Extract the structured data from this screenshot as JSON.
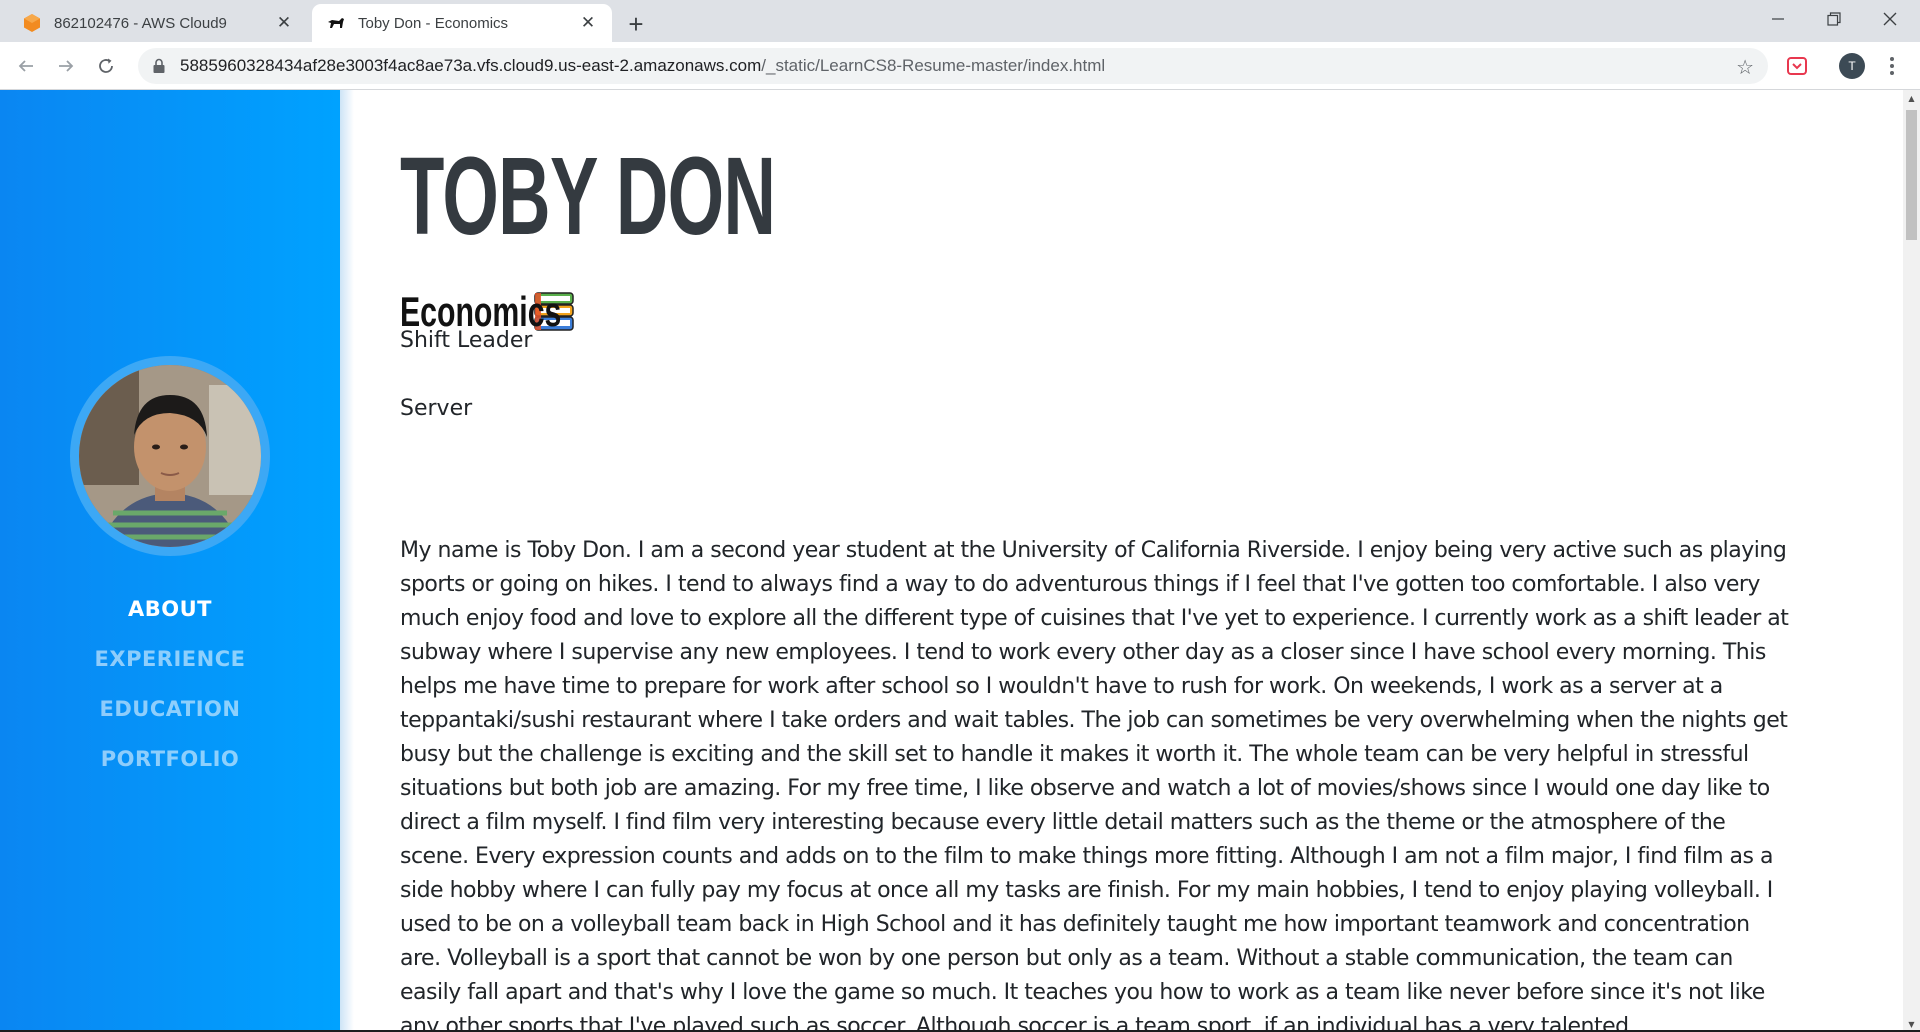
{
  "browser": {
    "tabs": [
      {
        "title": "862102476 - AWS Cloud9",
        "icon": "aws-cloud9-icon",
        "active": false
      },
      {
        "title": "Toby Don - Economics",
        "icon": "dog-favicon-icon",
        "active": true
      }
    ],
    "url_host": "5885960328434af28e3003f4ac8ae73a.vfs.cloud9.us-east-2.amazonaws.com",
    "url_path": "/_static/LearnCS8-Resume-master/index.html",
    "profile_initial": "T"
  },
  "sidebar": {
    "gradient_start": "#0a86f2",
    "gradient_end": "#00a2ff",
    "nav": [
      {
        "label": "ABOUT",
        "active": true
      },
      {
        "label": "EXPERIENCE",
        "active": false
      },
      {
        "label": "EDUCATION",
        "active": false
      },
      {
        "label": "PORTFOLIO",
        "active": false
      }
    ]
  },
  "about": {
    "name": "TOBY DON",
    "subheading": "Economics",
    "subheading_icon": "books-icon",
    "roles": [
      "Shift Leader",
      "Server"
    ],
    "bio": "My name is Toby Don. I am a second year student at the University of California Riverside. I enjoy being very active such as playing sports or going on hikes. I tend to always find a way to do adventurous things if I feel that I've gotten too comfortable. I also very much enjoy food and love to explore all the different type of cuisines that I've yet to experience. I currently work as a shift leader at subway where I supervise any new employees. I tend to work every other day as a closer since I have school every morning. This helps me have time to prepare for work after school so I wouldn't have to rush for work. On weekends, I work as a server at a teppantaki/sushi restaurant where I take orders and wait tables. The job can sometimes be very overwhelming when the nights get busy but the challenge is exciting and the skill set to handle it makes it worth it. The whole team can be very helpful in stressful situations but both job are amazing. For my free time, I like observe and watch a lot of movies/shows since I would one day like to direct a film myself. I find film very interesting because every little detail matters such as the theme or the atmosphere of the scene. Every expression counts and adds on to the film to make things more fitting. Although I am not a film major, I find film as a side hobby where I can fully pay my focus at once all my tasks are finish. For my main hobbies, I tend to enjoy playing volleyball. I used to be on a volleyball team back in High School and it has definitely taught me how important teamwork and concentration are. Volleyball is a sport that cannot be won by one person but only as a team. Without a stable communication, the team can easily fall apart and that's why I love the game so much. It teaches you how to work as a team like never before since it's not like any other sports that I've played such as soccer. Although soccer is a team sport, if an individual has a very talented"
  }
}
